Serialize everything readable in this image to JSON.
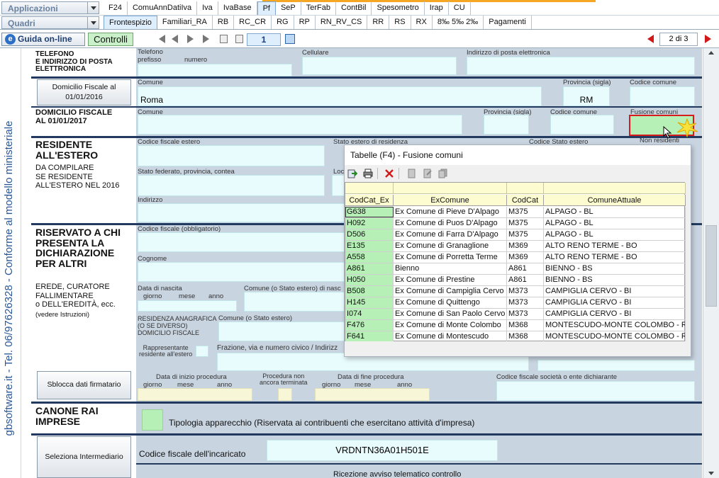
{
  "top": {
    "combo1": "Applicazioni",
    "combo2": "Quadri",
    "tabs_row1": [
      {
        "label": "F24"
      },
      {
        "label": "ComuAnnDatiIva"
      },
      {
        "label": "Iva"
      },
      {
        "label": "IvaBase"
      },
      {
        "label": "Pf",
        "active": true
      },
      {
        "label": "SeP"
      },
      {
        "label": "TerFab"
      },
      {
        "label": "ContBil"
      },
      {
        "label": "Spesometro"
      },
      {
        "label": "Irap"
      },
      {
        "label": "CU"
      }
    ],
    "tabs_row2": [
      {
        "label": "Frontespizio",
        "active": true
      },
      {
        "label": "Familiari_RA"
      },
      {
        "label": "RB"
      },
      {
        "label": "RC_CR"
      },
      {
        "label": "RG"
      },
      {
        "label": "RP"
      },
      {
        "label": "RN_RV_CS"
      },
      {
        "label": "RR"
      },
      {
        "label": "RS"
      },
      {
        "label": "RX"
      },
      {
        "label": "8‰ 5‰ 2‰"
      },
      {
        "label": "Pagamenti"
      }
    ]
  },
  "toolbar": {
    "guida_label": "Guida on-line",
    "guida_icon": "e",
    "controlli_label": "Controlli",
    "page_number": "1",
    "page_of": "2 di 3"
  },
  "vertical_text": "gbsoftware.it - Tel. 06/97626328 - Conforme al modello ministeriale",
  "form": {
    "telefono": {
      "heading": "TELEFONO\nE INDIRIZZO DI POSTA\nELETTRONICA",
      "lbl_telefono": "Telefono",
      "lbl_prefisso": "prefisso",
      "lbl_numero": "numero",
      "lbl_cellulare": "Cellulare",
      "lbl_email": "Indirizzo di posta elettronica"
    },
    "domicilio_2016": {
      "button_label": "Domicilio Fiscale al 01/01/2016",
      "lbl_comune": "Comune",
      "comune_value": "Roma",
      "lbl_provincia": "Provincia (sigla)",
      "provincia_value": "RM",
      "lbl_codice": "Codice comune"
    },
    "domicilio_2017": {
      "heading": "DOMICILIO FISCALE\nAL 01/01/2017",
      "lbl_comune": "Comune",
      "lbl_provincia": "Provincia (sigla)",
      "lbl_codice": "Codice comune",
      "lbl_fusione": "Fusione comuni"
    },
    "residente": {
      "heading": "RESIDENTE\nALL'ESTERO",
      "sub": "DA COMPILARE\nSE RESIDENTE\nALL'ESTERO NEL 2016",
      "lbl_cf_estero": "Codice fiscale estero",
      "lbl_stato_estero": "Stato estero di residenza",
      "lbl_codice_stato": "Codice Stato estero",
      "lbl_non_residenti": "Non residenti",
      "lbl_stato_federato": "Stato federato, provincia, contea",
      "lbl_localita": "Loc",
      "lbl_indirizzo": "Indirizzo"
    },
    "riservato": {
      "heading": "RISERVATO A CHI\nPRESENTA LA\nDICHIARAZIONE\nPER ALTRI",
      "sub": "EREDE, CURATORE\nFALLIMENTARE\no DELL'EREDITÀ, ecc.",
      "sub2": "(vedere Istruzioni)",
      "lbl_cf": "Codice fiscale (obbligatorio)",
      "lbl_cognome": "Cognome",
      "lbl_data_nascita": "Data di nascita",
      "lbl_giorno": "giorno",
      "lbl_mese": "mese",
      "lbl_anno": "anno",
      "lbl_comune_nascita": "Comune (o Stato estero) di nasc",
      "lbl_residenza": "RESIDENZA ANAGRAFICA\n(O SE DIVERSO)\nDOMICILIO FISCALE",
      "lbl_comune_res": "Comune (o Stato estero)",
      "lbl_rappresentante": "Rappresentante\nresidente all'estero",
      "lbl_frazione": "Frazione, via e numero civico / Indirizz"
    },
    "procedura": {
      "button_label": "Sblocca dati firmatario",
      "lbl_inizio": "Data di inizio procedura",
      "lbl_non_terminata": "Procedura non\nancora terminata",
      "lbl_fine": "Data di fine procedura",
      "lbl_cf_societa": "Codice fiscale società o ente dichiarante",
      "lbl_giorno": "giorno",
      "lbl_mese": "mese",
      "lbl_anno": "anno"
    },
    "canone": {
      "heading": "CANONE RAI\nIMPRESE",
      "lbl_tipologia": "Tipologia apparecchio (Riservata ai contribuenti che esercitano attività d'impresa)"
    },
    "intermediario": {
      "button_label": "Seleziona Intermediario",
      "lbl_cf_incaricato": "Codice fiscale dell'incaricato",
      "cf_incaricato_value": "VRDNTN36A01H501E",
      "lbl_ricezione": "Ricezione avviso telematico controllo"
    }
  },
  "dialog": {
    "title": "Tabelle (F4) - Fusione comuni",
    "columns": [
      "CodCat_Ex",
      "ExComune",
      "CodCat",
      "ComuneAttuale"
    ],
    "rows": [
      {
        "codcat_ex": "G638",
        "excomune": "Ex Comune di Pieve D'Alpago",
        "codcat": "M375",
        "comune": "ALPAGO - BL",
        "selected": true
      },
      {
        "codcat_ex": "H092",
        "excomune": "Ex Comune di Puos D'Alpago",
        "codcat": "M375",
        "comune": "ALPAGO - BL"
      },
      {
        "codcat_ex": "D506",
        "excomune": "Ex Comune di Farra D'Alpago",
        "codcat": "M375",
        "comune": "ALPAGO - BL"
      },
      {
        "codcat_ex": "E135",
        "excomune": "Ex Comune di Granaglione",
        "codcat": "M369",
        "comune": "ALTO RENO TERME - BO"
      },
      {
        "codcat_ex": "A558",
        "excomune": "Ex Comune di Porretta Terme",
        "codcat": "M369",
        "comune": "ALTO RENO TERME - BO"
      },
      {
        "codcat_ex": "A861",
        "excomune": "Bienno",
        "codcat": "A861",
        "comune": "BIENNO - BS"
      },
      {
        "codcat_ex": "H050",
        "excomune": "Ex Comune di Prestine",
        "codcat": "A861",
        "comune": "BIENNO - BS"
      },
      {
        "codcat_ex": "B508",
        "excomune": "Ex Comune di Campiglia Cervo",
        "codcat": "M373",
        "comune": "CAMPIGLIA CERVO - BI"
      },
      {
        "codcat_ex": "H145",
        "excomune": "Ex Comune di Quittengo",
        "codcat": "M373",
        "comune": "CAMPIGLIA CERVO - BI"
      },
      {
        "codcat_ex": "I074",
        "excomune": "Ex Comune di San Paolo Cervo",
        "codcat": "M373",
        "comune": "CAMPIGLIA CERVO - BI"
      },
      {
        "codcat_ex": "F476",
        "excomune": "Ex Comune di Monte Colombo",
        "codcat": "M368",
        "comune": "MONTESCUDO-MONTE COLOMBO - RN"
      },
      {
        "codcat_ex": "F641",
        "excomune": "Ex Comune di Montescudo",
        "codcat": "M368",
        "comune": "MONTESCUDO-MONTE COLOMBO - RN"
      }
    ]
  },
  "colors": {
    "field_bg": "#e8fbfd",
    "form_bg": "#c8d4e0",
    "section_separator": "#223a60",
    "highlight_green": "#b6f0b6",
    "focus_border": "#d81c1c",
    "vertical_text": "#2b5796"
  }
}
